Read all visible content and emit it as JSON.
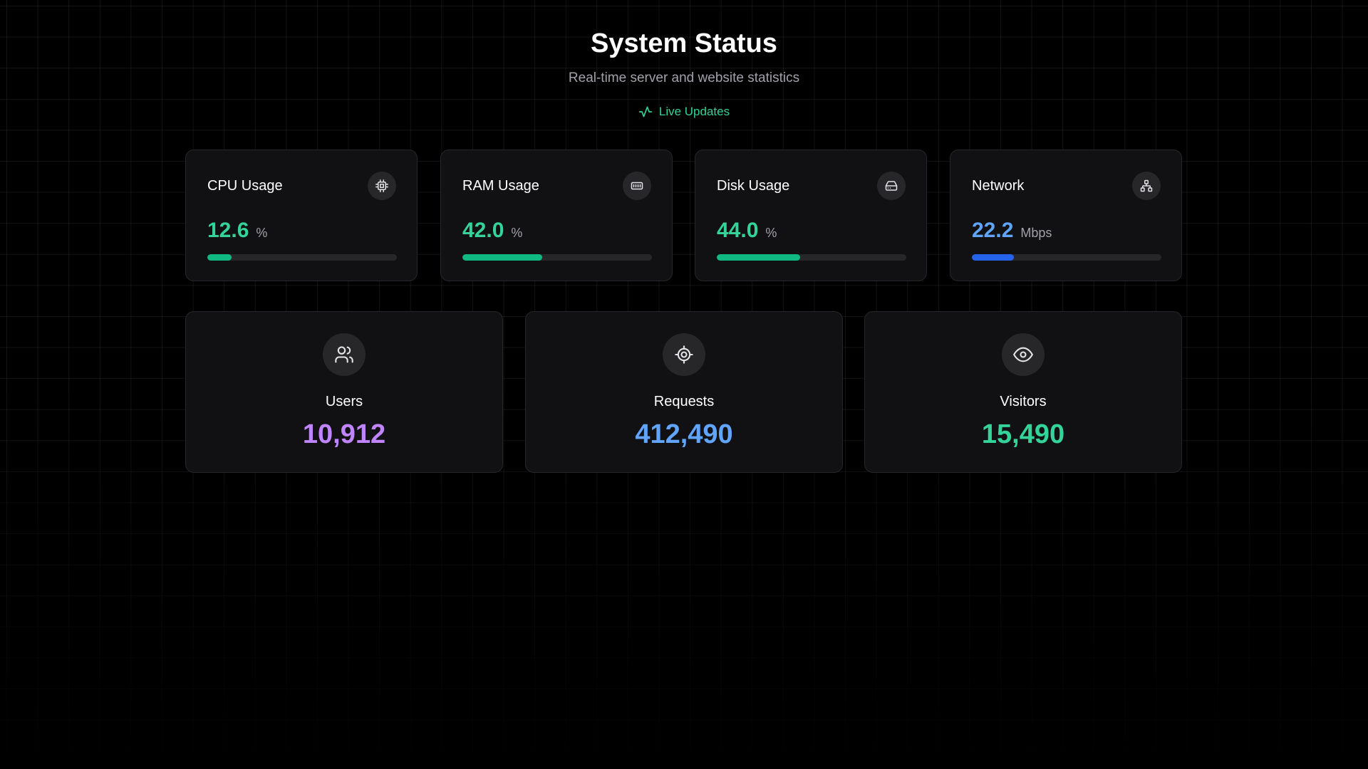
{
  "header": {
    "title": "System Status",
    "subtitle": "Real-time server and website statistics",
    "live_label": "Live Updates",
    "live_icon": "activity-icon",
    "live_color": "#34d399"
  },
  "stats": [
    {
      "label": "CPU Usage",
      "value": "12.6",
      "unit": "%",
      "icon": "cpu-icon",
      "progress": 12.6,
      "value_color": "#34d399",
      "bar_color": "#10b981"
    },
    {
      "label": "RAM Usage",
      "value": "42.0",
      "unit": "%",
      "icon": "memory-icon",
      "progress": 42.0,
      "value_color": "#34d399",
      "bar_color": "#10b981"
    },
    {
      "label": "Disk Usage",
      "value": "44.0",
      "unit": "%",
      "icon": "hard-drive-icon",
      "progress": 44.0,
      "value_color": "#34d399",
      "bar_color": "#10b981"
    },
    {
      "label": "Network",
      "value": "22.2",
      "unit": "Mbps",
      "icon": "network-icon",
      "progress": 22.2,
      "value_color": "#60a5fa",
      "bar_color": "#2563eb"
    }
  ],
  "totals": [
    {
      "label": "Users",
      "value": "10,912",
      "icon": "users-icon",
      "value_color": "#c084fc"
    },
    {
      "label": "Requests",
      "value": "412,490",
      "icon": "crosshair-icon",
      "value_color": "#60a5fa"
    },
    {
      "label": "Visitors",
      "value": "15,490",
      "icon": "eye-icon",
      "value_color": "#34d399"
    }
  ]
}
